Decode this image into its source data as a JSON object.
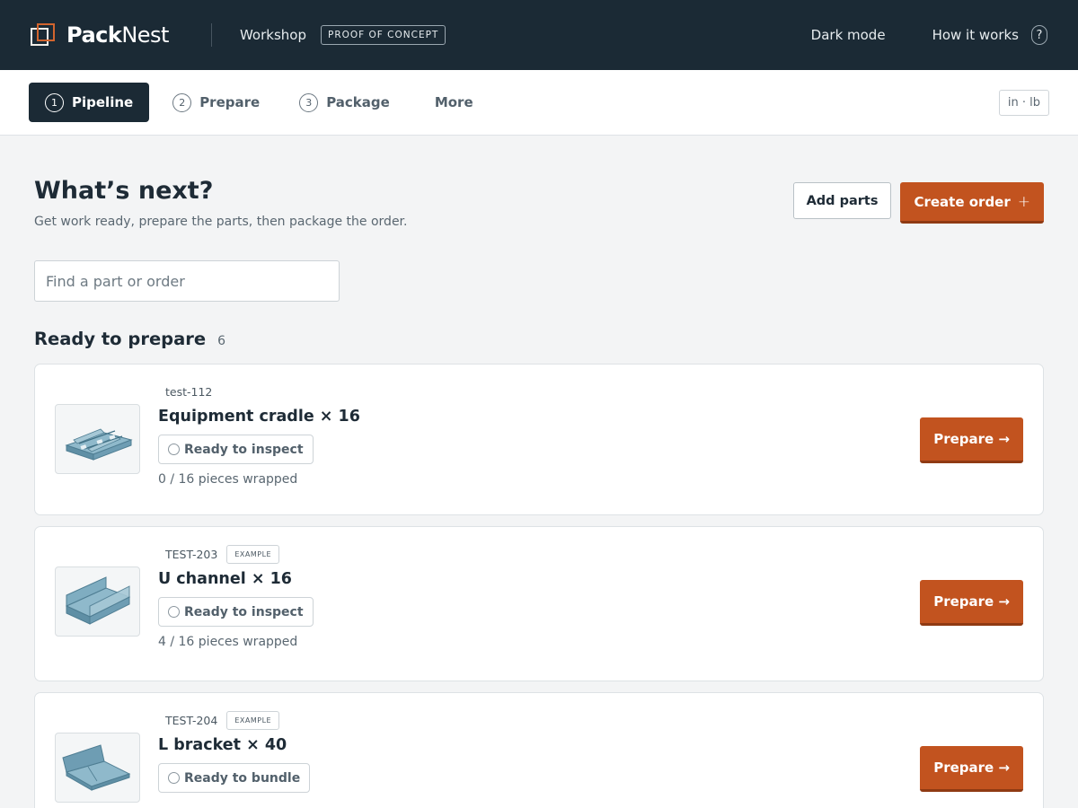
{
  "header": {
    "brand_bold": "Pack",
    "brand_light": "Nest",
    "workshop_label": "Workshop",
    "poc_badge": "PROOF OF CONCEPT",
    "dark_mode_label": "Dark mode",
    "how_it_works_label": "How it works",
    "help_symbol": "?"
  },
  "tabs": [
    {
      "num": "1",
      "label": "Pipeline",
      "active": true
    },
    {
      "num": "2",
      "label": "Prepare",
      "active": false
    },
    {
      "num": "3",
      "label": "Package",
      "active": false
    },
    {
      "num": "",
      "label": "More",
      "active": false
    }
  ],
  "units_toggle": "in · lb",
  "page": {
    "title": "What’s next?",
    "subtitle": "Get work ready, prepare the parts, then package the order.",
    "add_parts_label": "Add parts",
    "create_order_label": "Create order",
    "create_order_symbol": "+"
  },
  "search": {
    "placeholder": "Find a part or order",
    "value": ""
  },
  "section": {
    "title": "Ready to prepare",
    "count": "6"
  },
  "cards": [
    {
      "id": "test-112",
      "badge": "",
      "name": "Equipment cradle × 16",
      "status": "Ready to inspect",
      "progress": "0 / 16 pieces wrapped",
      "button": "Prepare →",
      "icon": "cradle-part-icon"
    },
    {
      "id": "TEST-203",
      "badge": "EXAMPLE",
      "name": "U channel × 16",
      "status": "Ready to inspect",
      "progress": "4 / 16 pieces wrapped",
      "button": "Prepare →",
      "icon": "u-channel-part-icon"
    },
    {
      "id": "TEST-204",
      "badge": "EXAMPLE",
      "name": "L bracket × 40",
      "status": "Ready to bundle",
      "progress": "",
      "button": "Prepare →",
      "icon": "l-bracket-part-icon"
    }
  ],
  "colors": {
    "topbar": "#1b2a35",
    "accent": "#c2531f",
    "part_fill": "#6e9db3"
  }
}
